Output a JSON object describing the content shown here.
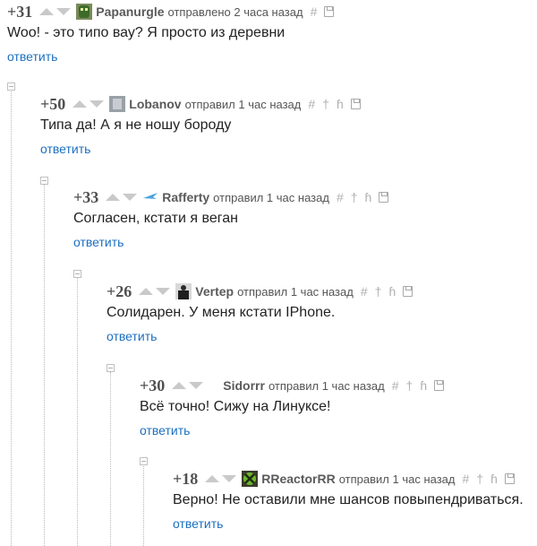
{
  "comments": [
    {
      "rating": "+31",
      "author": "Papanurgle",
      "time": "отправлено 2 часа назад",
      "text": "Woo! - это типо вау? Я просто из деревни",
      "reply": "ответить",
      "avatar": "green-creature-avatar"
    },
    {
      "rating": "+50",
      "author": "Lobanov",
      "time": "отправил 1 час назад",
      "text": "Типа да! А я не ношу бороду",
      "reply": "ответить",
      "avatar": "gray-avatar"
    },
    {
      "rating": "+33",
      "author": "Rafferty",
      "time": "отправил 1 час назад",
      "text": "Согласен, кстати я веган",
      "reply": "ответить",
      "avatar": "blue-bird-avatar"
    },
    {
      "rating": "+26",
      "author": "Vertep",
      "time": "отправил 1 час назад",
      "text": "Солидарен. У меня кстати IPhone.",
      "reply": "ответить",
      "avatar": "person-suit-avatar"
    },
    {
      "rating": "+30",
      "author": "Sidorrr",
      "time": "отправил 1 час назад",
      "text": "Всё точно! Сижу на Линуксе!",
      "reply": "ответить",
      "avatar": ""
    },
    {
      "rating": "+18",
      "author": "RReactorRR",
      "time": "отправил 1 час назад",
      "text": "Верно! Не оставили мне шансов повыпендриваться.",
      "reply": "ответить",
      "avatar": "xbox-avatar"
    }
  ],
  "icons": {
    "link": "#",
    "pin": "pin-icon",
    "person": "person-icon",
    "save": "save-icon"
  },
  "colors": {
    "reply_link": "#1b6fc0",
    "rating": "#505050",
    "icons": "#b0b0b0"
  }
}
